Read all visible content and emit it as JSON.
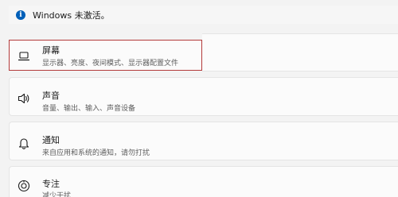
{
  "banner": {
    "text": "Windows 未激活。",
    "icon": "info-icon",
    "color": "#005fb8"
  },
  "settings_items": [
    {
      "title": "屏幕",
      "subtitle": "显示器、亮度、夜间模式、显示器配置文件",
      "icon": "laptop-icon"
    },
    {
      "title": "声音",
      "subtitle": "音量、输出、输入、声音设备",
      "icon": "speaker-icon"
    },
    {
      "title": "通知",
      "subtitle": "来自应用和系统的通知，请勿打扰",
      "icon": "bell-icon"
    },
    {
      "title": "专注",
      "subtitle": "减少干扰",
      "icon": "focus-icon"
    }
  ],
  "colors": {
    "highlight_border": "#b33a3a",
    "background": "#f3f3f3",
    "card": "#fbfbfb"
  }
}
